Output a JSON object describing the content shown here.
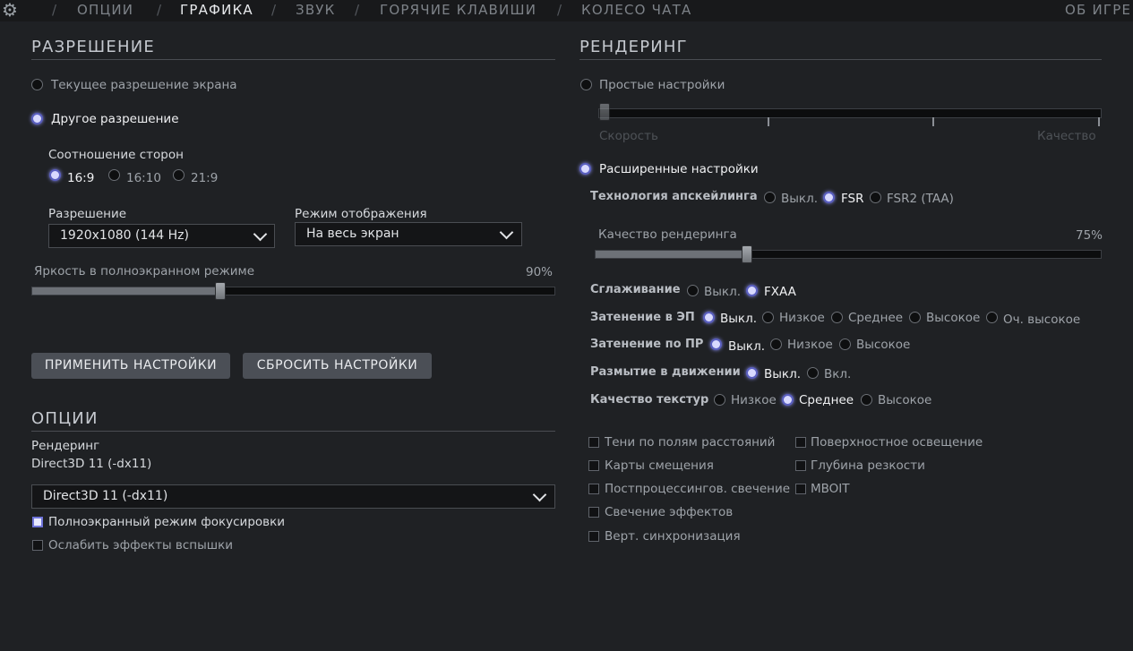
{
  "tabs": {
    "options": "ОПЦИИ",
    "graphics": "ГРАФИКА",
    "sound": "ЗВУК",
    "hotkeys": "ГОРЯЧИЕ КЛАВИШИ",
    "chat_wheel": "КОЛЕСО ЧАТА",
    "about": "ОБ ИГРЕ",
    "separator": "/",
    "active": "ГРАФИКА"
  },
  "resolution": {
    "heading": "РАЗРЕШЕНИЕ",
    "current_label": "Текущее разрешение экрана",
    "custom_label": "Другое разрешение",
    "selected": "Другое разрешение",
    "aspect_label": "Соотношение сторон",
    "aspect_options": [
      "16:9",
      "16:10",
      "21:9"
    ],
    "aspect_selected": "16:9",
    "resolution_label": "Разрешение",
    "resolution_value": "1920x1080 (144 Hz)",
    "display_mode_label": "Режим отображения",
    "display_mode_value": "На весь экран",
    "brightness_label": "Яркость в полноэкранном режиме",
    "brightness_value_text": "90%",
    "brightness_value": 90,
    "apply_button": "ПРИМЕНИТЬ НАСТРОЙКИ",
    "reset_button": "СБРОСИТЬ НАСТРОЙКИ"
  },
  "options": {
    "heading": "ОПЦИИ",
    "rendering_label": "Рендеринг",
    "rendering_current": "Direct3D 11 (-dx11)",
    "rendering_dropdown": "Direct3D 11 (-dx11)",
    "fullscreen_focus_label": "Полноэкранный режим фокусировки",
    "fullscreen_focus_checked": true,
    "reduce_flash_label": "Ослабить эффекты вспышки",
    "reduce_flash_checked": false
  },
  "rendering": {
    "heading": "РЕНДЕРИНГ",
    "simple_label": "Простые настройки",
    "simple_left": "Скорость",
    "simple_right": "Качество",
    "advanced_label": "Расширенные настройки",
    "mode_selected": "Расширенные настройки",
    "upscaling": {
      "label": "Технология апскейлинга",
      "options": [
        "Выкл.",
        "FSR",
        "FSR2 (TAA)"
      ],
      "selected": "FSR"
    },
    "render_quality_label": "Качество рендеринга",
    "render_quality_value_text": "75%",
    "render_quality_value": 75,
    "antialiasing": {
      "label": "Сглаживание",
      "options": [
        "Выкл.",
        "FXAA"
      ],
      "selected": "FXAA"
    },
    "ssao": {
      "label": "Затенение в ЭП",
      "options": [
        "Выкл.",
        "Низкое",
        "Среднее",
        "Высокое",
        "Оч. высокое"
      ],
      "selected": "Выкл."
    },
    "shadow_pr": {
      "label": "Затенение по ПР",
      "options": [
        "Выкл.",
        "Низкое",
        "Высокое"
      ],
      "selected": "Выкл."
    },
    "motion_blur": {
      "label": "Размытие в движении",
      "options": [
        "Выкл.",
        "Вкл."
      ],
      "selected": "Выкл."
    },
    "texture_quality": {
      "label": "Качество текстур",
      "options": [
        "Низкое",
        "Среднее",
        "Высокое"
      ],
      "selected": "Среднее"
    },
    "checkboxes": [
      {
        "label": "Тени по полям расстояний",
        "checked": false
      },
      {
        "label": "Поверхностное освещение",
        "checked": false
      },
      {
        "label": "Карты смещения",
        "checked": false
      },
      {
        "label": "Глубина резкости",
        "checked": false
      },
      {
        "label": "Постпроцессингов. свечение",
        "checked": false
      },
      {
        "label": "MBOIT",
        "checked": false
      },
      {
        "label": "Свечение эффектов",
        "checked": false
      },
      {
        "label": "Верт. синхронизация",
        "checked": false
      }
    ]
  },
  "icons": {
    "settings": "gear-icon",
    "dropdown": "chevron-down-icon"
  },
  "colors": {
    "background": "#1f2124",
    "accent": "#5a5fc0",
    "button": "#4b4f56"
  }
}
